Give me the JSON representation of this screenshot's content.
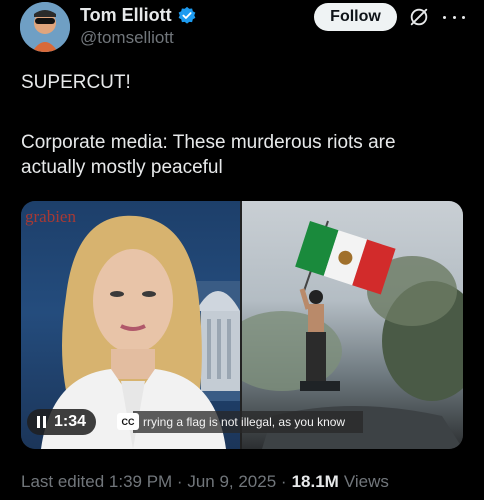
{
  "author": {
    "name": "Tom Elliott",
    "handle": "@tomselliott",
    "avatar_icon": "avatar-photo"
  },
  "actions": {
    "follow_label": "Follow",
    "grok_icon": "grok-slash-icon",
    "more_icon": "more-horizontal-icon"
  },
  "tweet": {
    "line1": "SUPERCUT!",
    "line2": "Corporate media: These murderous riots are actually mostly peaceful"
  },
  "media": {
    "watermark": "grabien",
    "time": "1:34",
    "cc_label": "CC",
    "caption": "rrying a flag is not illegal, as you know"
  },
  "meta": {
    "edited": "Last edited 1:39 PM · Jun 9, 2025 ·",
    "views_count": "18.1M",
    "views_label": "Views"
  },
  "colors": {
    "background": "#000000",
    "text": "#e7e9ea",
    "muted": "#71767b",
    "verified": "#1d9bf0",
    "flag_green": "#1a8a3c",
    "flag_red": "#d22b2b"
  }
}
